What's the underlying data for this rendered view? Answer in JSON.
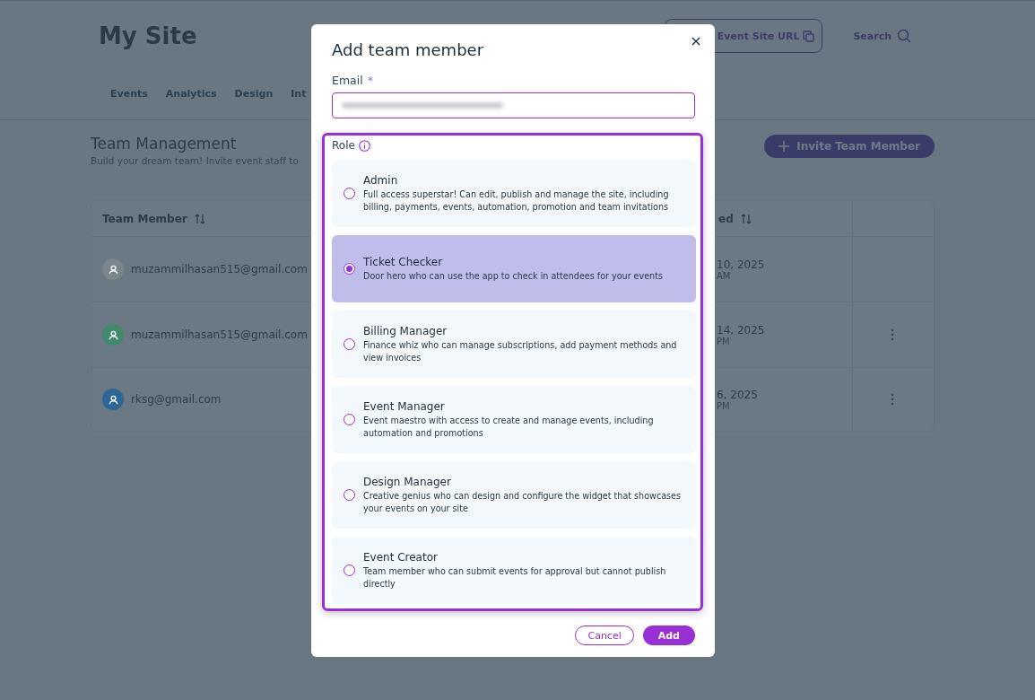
{
  "site_title": "My Site",
  "header": {
    "site_url_button": "Event Site URL",
    "search_button": "Search"
  },
  "nav_tabs": [
    "Events",
    "Analytics",
    "Design",
    "Int"
  ],
  "section": {
    "title": "Team Management",
    "subtitle": "Build your dream team! Invite event staff to",
    "invite_button": "Invite Team Member"
  },
  "table": {
    "columns": [
      "Team Member",
      "ed"
    ],
    "rows": [
      {
        "member": "muzammilhasan515@gmail.com",
        "color": "#7b858c",
        "date": "10, 2025",
        "time": "AM",
        "has_menu": false
      },
      {
        "member": "muzammilhasan515@gmail.com",
        "color": "#3f8a6a",
        "date": "14, 2025",
        "time": "PM",
        "has_menu": true
      },
      {
        "member": "rksg@gmail.com",
        "color": "#2d6694",
        "date": "6, 2025",
        "time": "PM",
        "has_menu": true
      }
    ]
  },
  "modal": {
    "title": "Add team member",
    "email_label": "Email",
    "required_mark": "*",
    "role_label": "Role",
    "roles": [
      {
        "name": "Admin",
        "description": "Full access superstar! Can edit, publish and manage the site, including billing, payments, events, automation, promotion and team invitations",
        "selected": false
      },
      {
        "name": "Ticket Checker",
        "description": "Door hero who can use the app to check in attendees for your events",
        "selected": true
      },
      {
        "name": "Billing Manager",
        "description": "Finance whiz who can manage subscriptions, add payment methods and view invoices",
        "selected": false
      },
      {
        "name": "Event Manager",
        "description": "Event maestro with access to create and manage events, including automation and promotions",
        "selected": false
      },
      {
        "name": "Design Manager",
        "description": "Creative genius who can design and configure the widget that showcases your events on your site",
        "selected": false
      },
      {
        "name": "Event Creator",
        "description": "Team member who can submit events for approval but cannot publish directly",
        "selected": false
      }
    ],
    "cancel_button": "Cancel",
    "add_button": "Add"
  }
}
